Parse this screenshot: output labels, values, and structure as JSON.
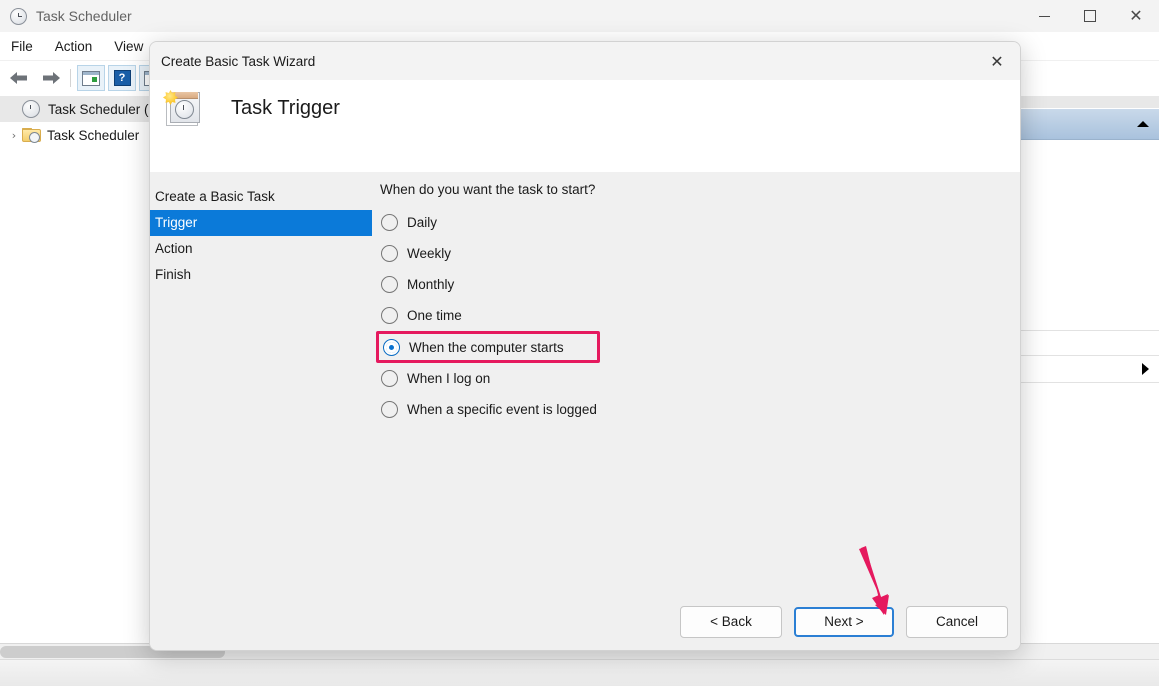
{
  "app_window": {
    "title": "Task Scheduler",
    "title_icon": "clock-icon",
    "controls": {
      "minimize": "minimize-icon",
      "maximize": "maximize-icon",
      "close": "✕"
    },
    "menu": [
      "File",
      "Action",
      "View"
    ],
    "toolbar": {
      "back_icon": "←",
      "forward_icon": "→",
      "list_icon": "show-hide-console-tree-icon",
      "help_icon": "?",
      "properties_icon": "properties-icon"
    },
    "tree": [
      {
        "label": "Task Scheduler (Lo",
        "icon": "clock-icon",
        "expander": "",
        "selected": true
      },
      {
        "label": "Task Scheduler",
        "icon": "folder-clock-icon",
        "expander": "›",
        "selected": false
      }
    ],
    "right_panel": {
      "collapse_icon": "triangle-up-icon",
      "expand_icon": "triangle-right-icon"
    }
  },
  "wizard": {
    "title": "Create Basic Task Wizard",
    "close_label": "✕",
    "banner": {
      "icon": "task-trigger-calendar-clock-icon",
      "heading": "Task Trigger"
    },
    "steps": [
      {
        "label": "Create a Basic Task",
        "active": false
      },
      {
        "label": "Trigger",
        "active": true
      },
      {
        "label": "Action",
        "active": false
      },
      {
        "label": "Finish",
        "active": false
      }
    ],
    "question": "When do you want the task to start?",
    "options": [
      {
        "label": "Daily",
        "checked": false,
        "highlighted": false
      },
      {
        "label": "Weekly",
        "checked": false,
        "highlighted": false
      },
      {
        "label": "Monthly",
        "checked": false,
        "highlighted": false
      },
      {
        "label": "One time",
        "checked": false,
        "highlighted": false
      },
      {
        "label": "When the computer starts",
        "checked": true,
        "highlighted": true
      },
      {
        "label": "When I log on",
        "checked": false,
        "highlighted": false
      },
      {
        "label": "When a specific event is logged",
        "checked": false,
        "highlighted": false
      }
    ],
    "buttons": {
      "back": "< Back",
      "next": "Next >",
      "cancel": "Cancel"
    }
  },
  "annotations": {
    "highlight_color": "#e5195e",
    "arrow_color": "#e5195e",
    "accent_blue": "#0b7ad9"
  }
}
